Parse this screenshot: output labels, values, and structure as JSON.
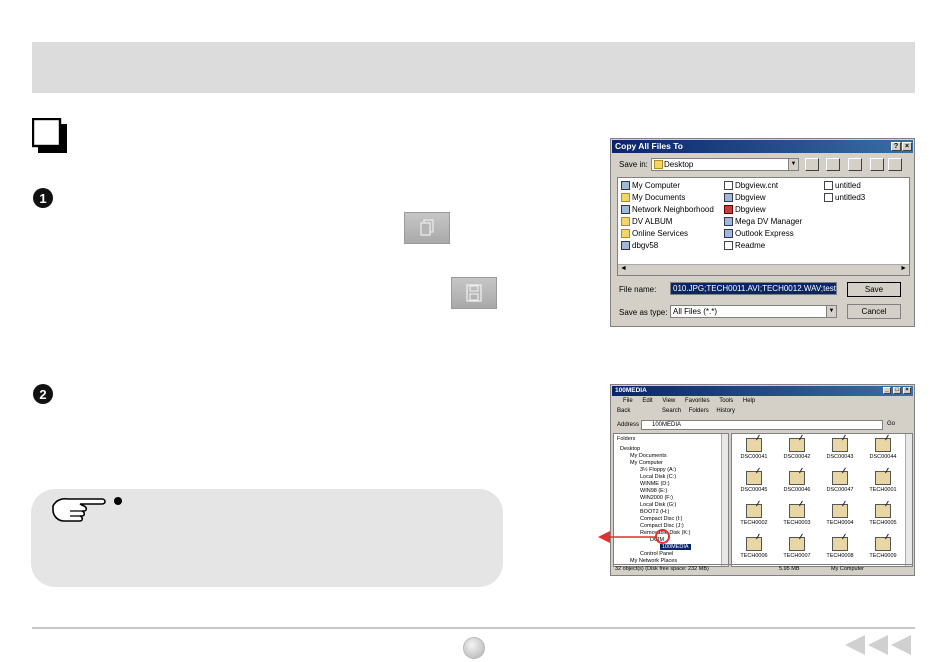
{
  "dialog_copy": {
    "title": "Copy All Files To",
    "title_buttons": [
      "?",
      "×"
    ],
    "save_in_label": "Save in:",
    "save_in_value": "Desktop",
    "items_col1": [
      "My Computer",
      "My Documents",
      "Network Neighborhood",
      "DV ALBUM",
      "Online Services",
      "dbgv58"
    ],
    "items_col2": [
      "Dbgview.cnt",
      "Dbgview",
      "Dbgview",
      "Mega DV Manager",
      "Outlook Express",
      "Readme"
    ],
    "items_col3": [
      "untitled",
      "untitled3"
    ],
    "file_name_label": "File name:",
    "file_name_value": "010.JPG;TECH0011.AVI;TECH0012.WAV;test",
    "save_as_type_label": "Save as type:",
    "save_as_type_value": "All Files (*.*)",
    "save_button": "Save",
    "cancel_button": "Cancel"
  },
  "dialog_explorer": {
    "title": "100MEDIA",
    "title_buttons": [
      "_",
      "□",
      "×"
    ],
    "menu": [
      "File",
      "Edit",
      "View",
      "Favorites",
      "Tools",
      "Help"
    ],
    "toolbar": [
      "Back",
      "Search",
      "Folders",
      "History"
    ],
    "address_label": "Address",
    "address_value": "100MEDIA",
    "go_label": "Go",
    "folders_label": "Folders",
    "tree": [
      "Desktop",
      "My Documents",
      "My Computer",
      "3½ Floppy (A:)",
      "Local Disk (C:)",
      "WINME (D:)",
      "WIN98 (E:)",
      "WIN2000 (F:)",
      "Local Disk (G:)",
      "BOOT2 (H:)",
      "Compact Disc (I:)",
      "Compact Disc (J:)",
      "Removable Disk (K:)",
      "DCIM",
      "100MEDIA",
      "Control Panel",
      "My Network Places"
    ],
    "files": [
      "DSC00041",
      "DSC00042",
      "DSC00043",
      "DSC00044",
      "DSC00045",
      "DSC00046",
      "DSC00047",
      "TECH0001",
      "TECH0002",
      "TECH0003",
      "TECH0004",
      "TECH0005",
      "TECH0006",
      "TECH0007",
      "TECH0008",
      "TECH0009"
    ],
    "status_left": "32 object(s) (Disk free space: 232 MB)",
    "status_mid": "5.95 MB",
    "status_right": "My Computer"
  },
  "colors": {
    "header_band": "#dcdcdc",
    "note_box": "#e5e5e5",
    "titlebar": "#0a246a",
    "marker": "#e03030"
  },
  "icons": {
    "section": "square-checkbox-icon",
    "copy": "copy-document-icon",
    "save": "floppy-disk-icon",
    "note": "pointing-hand-icon",
    "nav": "triple-left-arrow-icon"
  }
}
